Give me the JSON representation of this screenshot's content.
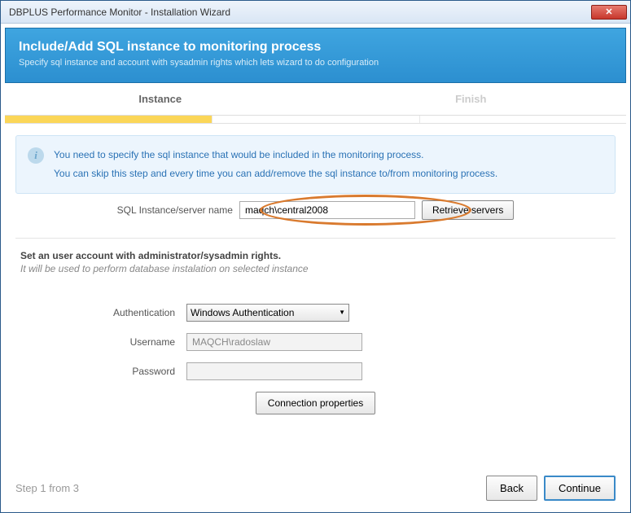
{
  "window": {
    "title": "DBPLUS Performance Monitor - Installation Wizard",
    "close_symbol": "✕"
  },
  "header": {
    "title": "Include/Add SQL instance to monitoring process",
    "subtitle": "Specify sql instance and account with sysadmin rights which lets wizard to do configuration"
  },
  "tabs": {
    "instance": "Instance",
    "finish": "Finish"
  },
  "info": {
    "line1": "You need to specify the sql instance that would be included in the monitoring process.",
    "line2": "You can skip this step and every time you can add/remove the sql instance to/from monitoring process."
  },
  "server": {
    "label": "SQL Instance/server name",
    "value": "maqch\\central2008",
    "retrieve_btn": "Retrieve servers"
  },
  "account_section": {
    "title_bold": "Set an user account with administrator/sysadmin rights.",
    "subtitle": "It will be used to perform database instalation on selected instance"
  },
  "auth": {
    "label": "Authentication",
    "selected": "Windows Authentication"
  },
  "username": {
    "label": "Username",
    "value": "MAQCH\\radoslaw"
  },
  "password": {
    "label": "Password",
    "value": ""
  },
  "conn_props_btn": "Connection properties",
  "footer": {
    "step": "Step 1 from 3",
    "back": "Back",
    "continue": "Continue"
  }
}
